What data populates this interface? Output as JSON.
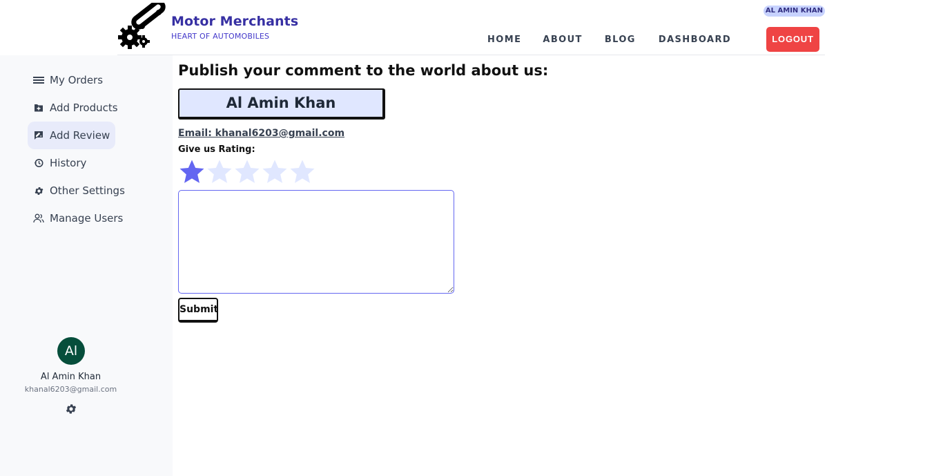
{
  "brand": {
    "title": "Motor Merchants",
    "subtitle": "HEART OF AUTOMOBILES",
    "logo_icon": "gears-chain-icon"
  },
  "header": {
    "user_badge": "AL AMIN KHAN",
    "nav": [
      "HOME",
      "ABOUT",
      "BLOG",
      "DASHBOARD"
    ],
    "logout_label": "LOGOUT"
  },
  "sidebar": {
    "items": [
      {
        "label": "My Orders",
        "icon": "menu-lines-icon",
        "active": false
      },
      {
        "label": "Add Products",
        "icon": "folder-plus-icon",
        "active": false
      },
      {
        "label": "Add Review",
        "icon": "review-icon",
        "active": true
      },
      {
        "label": "History",
        "icon": "history-icon",
        "active": false
      },
      {
        "label": "Other Settings",
        "icon": "gear-icon",
        "active": false
      },
      {
        "label": "Manage Users",
        "icon": "users-icon",
        "active": false
      }
    ],
    "profile": {
      "initials": "Al",
      "name": "Al Amin Khan",
      "email": "khanal6203@gmail.com"
    }
  },
  "main": {
    "heading": "Publish your comment to the world about us:",
    "name": "Al Amin Khan",
    "email_line": "Email: khanal6203@gmail.com",
    "rating_label": "Give us Rating:",
    "rating": 1,
    "rating_max": 5,
    "review_value": "",
    "submit_label": "Submit"
  },
  "colors": {
    "brand": "#3730a3",
    "logout": "#ef4444",
    "star_active": "#6366f1",
    "star_inactive": "#e0e7ff",
    "active_item_bg": "#e8ebfa"
  }
}
